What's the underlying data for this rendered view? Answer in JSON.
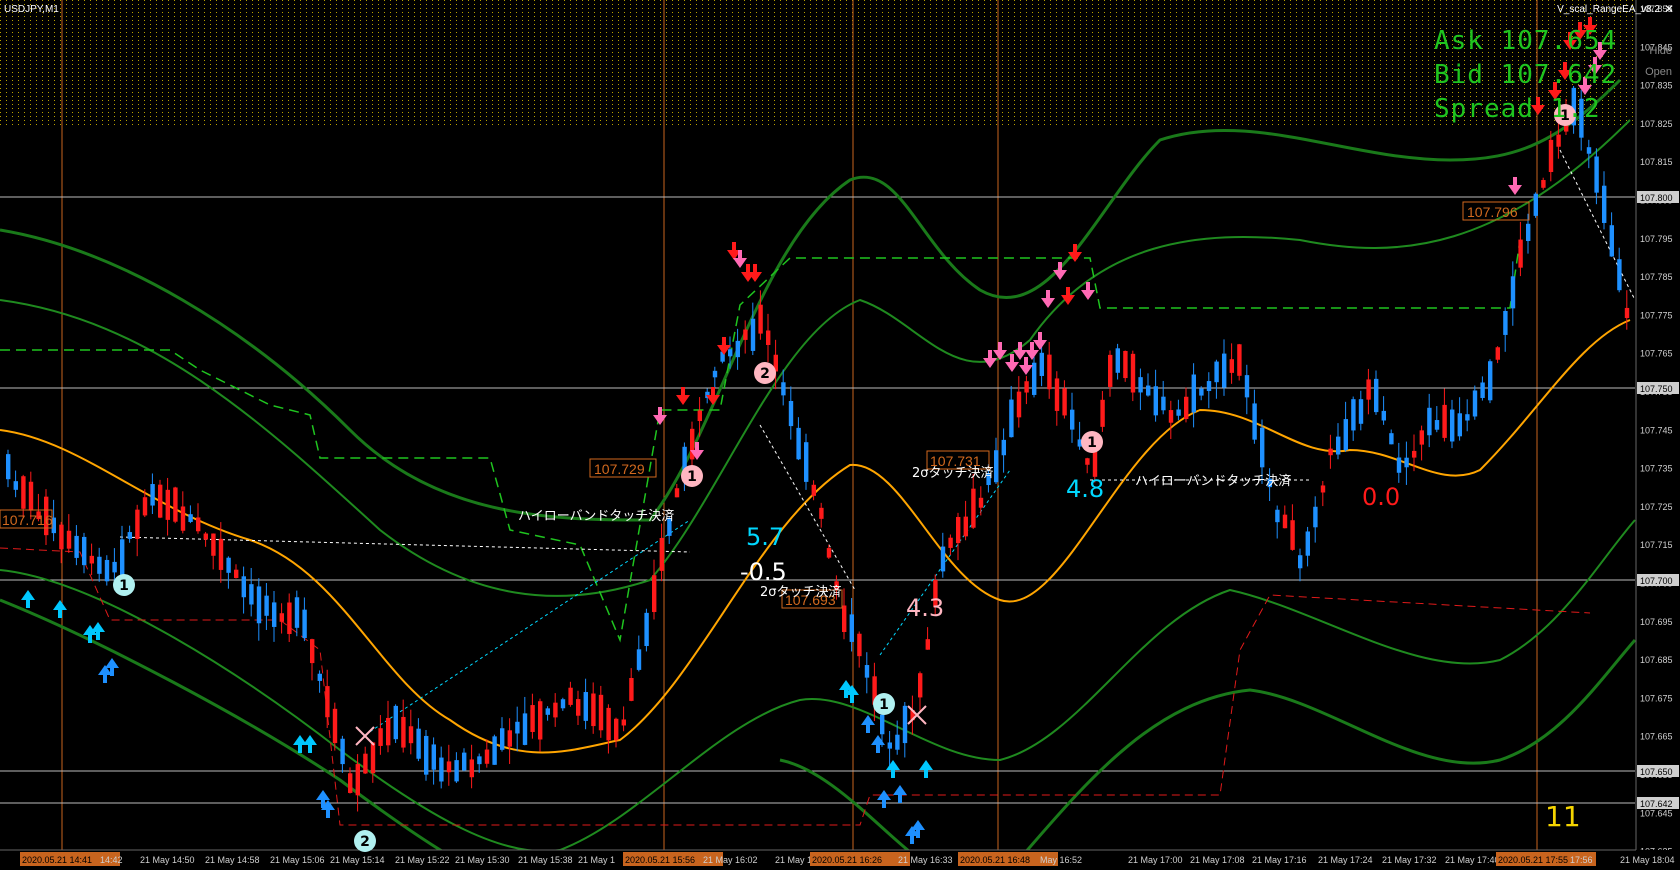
{
  "window": {
    "symbol_title": "USDJPY,M1",
    "ea_name": "V_scal_RangeEA_v8.2",
    "close_glyph": "✕",
    "hide_label": "Hide",
    "open_label": "Open"
  },
  "hud": {
    "ask": "Ask 107.654",
    "bid": "Bid 107.642",
    "spread": "Spread 1.2"
  },
  "corner_count": "11",
  "price_axis": {
    "labels": [
      "107.855",
      "107.845",
      "107.835",
      "107.825",
      "107.815",
      "107.805",
      "107.795",
      "107.785",
      "107.775",
      "107.765",
      "107.755",
      "107.745",
      "107.735",
      "107.725",
      "107.715",
      "107.705",
      "107.695",
      "107.685",
      "107.675",
      "107.665",
      "107.655",
      "107.645",
      "107.635"
    ],
    "highlighted": [
      "107.800",
      "107.750",
      "107.700",
      "107.650",
      "107.642"
    ]
  },
  "time_axis": [
    {
      "label": "2020.05.21 14:41",
      "highlight": true
    },
    {
      "label": "14:42",
      "highlight": false
    },
    {
      "label": "21 May 14:50",
      "highlight": false
    },
    {
      "label": "21 May 14:58",
      "highlight": false
    },
    {
      "label": "21 May 15:06",
      "highlight": false
    },
    {
      "label": "21 May 15:14",
      "highlight": false
    },
    {
      "label": "21 May 15:22",
      "highlight": false
    },
    {
      "label": "21 May 15:30",
      "highlight": false
    },
    {
      "label": "21 May 15:38",
      "highlight": false
    },
    {
      "label": "21 May 1",
      "highlight": false
    },
    {
      "label": "2020.05.21 15:56",
      "highlight": true
    },
    {
      "label": "21 May 16:02",
      "highlight": false
    },
    {
      "label": "21 May 1",
      "highlight": false
    },
    {
      "label": "2020.05.21 16:26",
      "highlight": true
    },
    {
      "label": "21 May 16:33",
      "highlight": false
    },
    {
      "label": "2020.05.21 16:48",
      "highlight": true
    },
    {
      "label": "May 16:52",
      "highlight": false
    },
    {
      "label": "21 May 17:00",
      "highlight": false
    },
    {
      "label": "21 May 17:08",
      "highlight": false
    },
    {
      "label": "21 May 17:16",
      "highlight": false
    },
    {
      "label": "21 May 17:24",
      "highlight": false
    },
    {
      "label": "21 May 17:32",
      "highlight": false
    },
    {
      "label": "21 May 17:40",
      "highlight": false
    },
    {
      "label": "21 N",
      "highlight": false
    },
    {
      "label": "2020.05.21 17:55",
      "highlight": true
    },
    {
      "label": "17:56",
      "highlight": false
    },
    {
      "label": "21 May 18:04",
      "highlight": false
    }
  ],
  "price_tags": [
    "107.729",
    "107.731",
    "107.796",
    "107.693",
    "107.716"
  ],
  "settlement_labels": {
    "hilo_band_1": "ハイローバンドタッチ決済",
    "sigma_touch_1": "2σタッチ決済",
    "sigma_touch_2": "2σタッチ決済",
    "hilo_band_2": "ハイローバンドタッチ決済"
  },
  "pnl_labels": {
    "p1": "5.7",
    "p2": "-0.5",
    "p3": "4.3",
    "p4": "4.8",
    "p5": "0.0"
  },
  "trade_markers": [
    "1",
    "2",
    "1",
    "2",
    "1",
    "1",
    "1"
  ],
  "colors": {
    "background": "#000000",
    "bull_candle": "#1e90ff",
    "bear_candle": "#ff1a1a",
    "band": "#1a7a1a",
    "band_inner": "#2e8b2e",
    "mid_ma": "#ffa500",
    "sell_arrow": "#ff1a1a",
    "sell_arrow_light": "#ff69b4",
    "buy_arrow": "#1e90ff",
    "buy_arrow_light": "#00c8ff",
    "hud_text": "#1fc41f"
  }
}
